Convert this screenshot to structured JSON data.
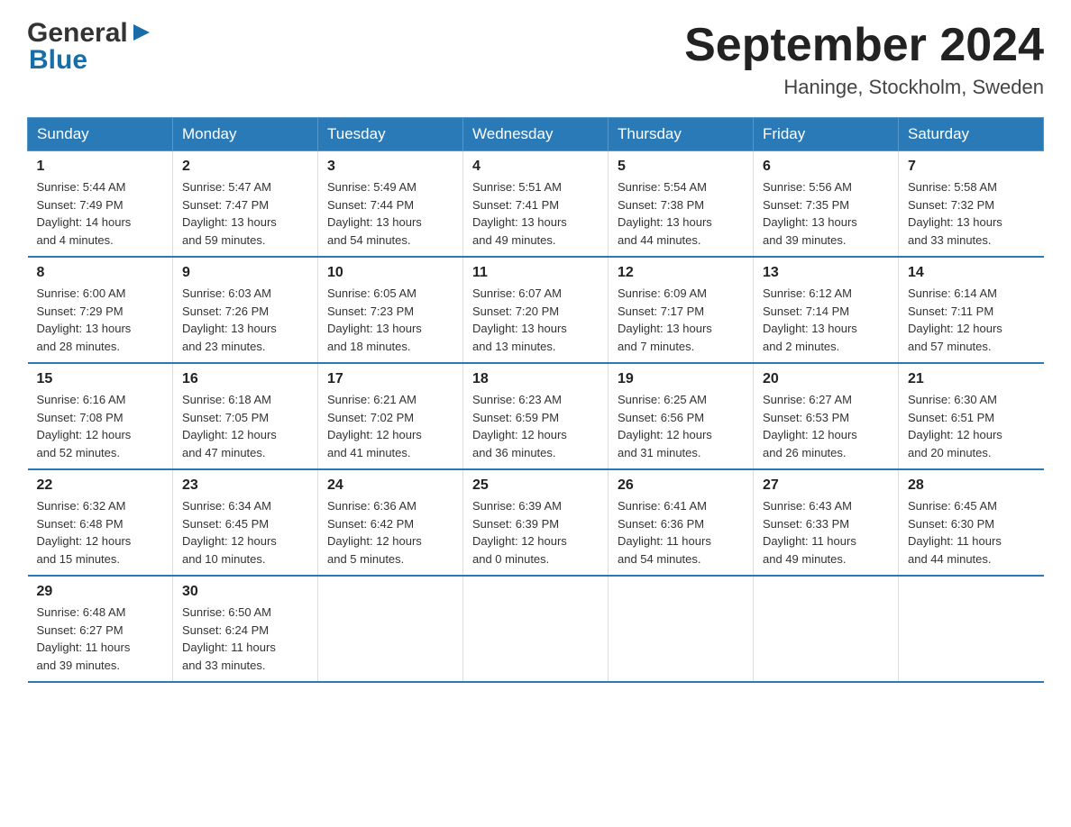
{
  "logo": {
    "general": "General",
    "blue": "Blue"
  },
  "title": "September 2024",
  "subtitle": "Haninge, Stockholm, Sweden",
  "weekdays": [
    "Sunday",
    "Monday",
    "Tuesday",
    "Wednesday",
    "Thursday",
    "Friday",
    "Saturday"
  ],
  "weeks": [
    [
      {
        "day": "1",
        "info": "Sunrise: 5:44 AM\nSunset: 7:49 PM\nDaylight: 14 hours\nand 4 minutes."
      },
      {
        "day": "2",
        "info": "Sunrise: 5:47 AM\nSunset: 7:47 PM\nDaylight: 13 hours\nand 59 minutes."
      },
      {
        "day": "3",
        "info": "Sunrise: 5:49 AM\nSunset: 7:44 PM\nDaylight: 13 hours\nand 54 minutes."
      },
      {
        "day": "4",
        "info": "Sunrise: 5:51 AM\nSunset: 7:41 PM\nDaylight: 13 hours\nand 49 minutes."
      },
      {
        "day": "5",
        "info": "Sunrise: 5:54 AM\nSunset: 7:38 PM\nDaylight: 13 hours\nand 44 minutes."
      },
      {
        "day": "6",
        "info": "Sunrise: 5:56 AM\nSunset: 7:35 PM\nDaylight: 13 hours\nand 39 minutes."
      },
      {
        "day": "7",
        "info": "Sunrise: 5:58 AM\nSunset: 7:32 PM\nDaylight: 13 hours\nand 33 minutes."
      }
    ],
    [
      {
        "day": "8",
        "info": "Sunrise: 6:00 AM\nSunset: 7:29 PM\nDaylight: 13 hours\nand 28 minutes."
      },
      {
        "day": "9",
        "info": "Sunrise: 6:03 AM\nSunset: 7:26 PM\nDaylight: 13 hours\nand 23 minutes."
      },
      {
        "day": "10",
        "info": "Sunrise: 6:05 AM\nSunset: 7:23 PM\nDaylight: 13 hours\nand 18 minutes."
      },
      {
        "day": "11",
        "info": "Sunrise: 6:07 AM\nSunset: 7:20 PM\nDaylight: 13 hours\nand 13 minutes."
      },
      {
        "day": "12",
        "info": "Sunrise: 6:09 AM\nSunset: 7:17 PM\nDaylight: 13 hours\nand 7 minutes."
      },
      {
        "day": "13",
        "info": "Sunrise: 6:12 AM\nSunset: 7:14 PM\nDaylight: 13 hours\nand 2 minutes."
      },
      {
        "day": "14",
        "info": "Sunrise: 6:14 AM\nSunset: 7:11 PM\nDaylight: 12 hours\nand 57 minutes."
      }
    ],
    [
      {
        "day": "15",
        "info": "Sunrise: 6:16 AM\nSunset: 7:08 PM\nDaylight: 12 hours\nand 52 minutes."
      },
      {
        "day": "16",
        "info": "Sunrise: 6:18 AM\nSunset: 7:05 PM\nDaylight: 12 hours\nand 47 minutes."
      },
      {
        "day": "17",
        "info": "Sunrise: 6:21 AM\nSunset: 7:02 PM\nDaylight: 12 hours\nand 41 minutes."
      },
      {
        "day": "18",
        "info": "Sunrise: 6:23 AM\nSunset: 6:59 PM\nDaylight: 12 hours\nand 36 minutes."
      },
      {
        "day": "19",
        "info": "Sunrise: 6:25 AM\nSunset: 6:56 PM\nDaylight: 12 hours\nand 31 minutes."
      },
      {
        "day": "20",
        "info": "Sunrise: 6:27 AM\nSunset: 6:53 PM\nDaylight: 12 hours\nand 26 minutes."
      },
      {
        "day": "21",
        "info": "Sunrise: 6:30 AM\nSunset: 6:51 PM\nDaylight: 12 hours\nand 20 minutes."
      }
    ],
    [
      {
        "day": "22",
        "info": "Sunrise: 6:32 AM\nSunset: 6:48 PM\nDaylight: 12 hours\nand 15 minutes."
      },
      {
        "day": "23",
        "info": "Sunrise: 6:34 AM\nSunset: 6:45 PM\nDaylight: 12 hours\nand 10 minutes."
      },
      {
        "day": "24",
        "info": "Sunrise: 6:36 AM\nSunset: 6:42 PM\nDaylight: 12 hours\nand 5 minutes."
      },
      {
        "day": "25",
        "info": "Sunrise: 6:39 AM\nSunset: 6:39 PM\nDaylight: 12 hours\nand 0 minutes."
      },
      {
        "day": "26",
        "info": "Sunrise: 6:41 AM\nSunset: 6:36 PM\nDaylight: 11 hours\nand 54 minutes."
      },
      {
        "day": "27",
        "info": "Sunrise: 6:43 AM\nSunset: 6:33 PM\nDaylight: 11 hours\nand 49 minutes."
      },
      {
        "day": "28",
        "info": "Sunrise: 6:45 AM\nSunset: 6:30 PM\nDaylight: 11 hours\nand 44 minutes."
      }
    ],
    [
      {
        "day": "29",
        "info": "Sunrise: 6:48 AM\nSunset: 6:27 PM\nDaylight: 11 hours\nand 39 minutes."
      },
      {
        "day": "30",
        "info": "Sunrise: 6:50 AM\nSunset: 6:24 PM\nDaylight: 11 hours\nand 33 minutes."
      },
      {
        "day": "",
        "info": ""
      },
      {
        "day": "",
        "info": ""
      },
      {
        "day": "",
        "info": ""
      },
      {
        "day": "",
        "info": ""
      },
      {
        "day": "",
        "info": ""
      }
    ]
  ]
}
